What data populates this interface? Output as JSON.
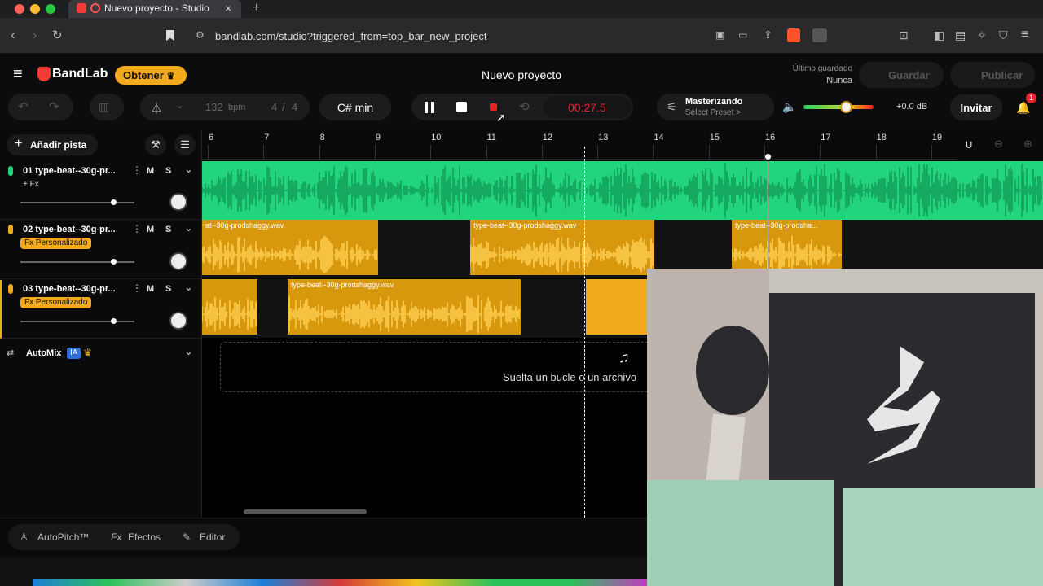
{
  "browser": {
    "tab_title": "Nuevo proyecto - Studio",
    "url": "bandlab.com/studio?triggered_from=top_bar_new_project",
    "new_tab": "+"
  },
  "app": {
    "logo": "BandLab",
    "obtener_label": "Obtener",
    "project_title": "Nuevo proyecto",
    "last_saved_label": "Último guardado",
    "last_saved_value": "Nunca",
    "save_label": "Guardar",
    "publish_label": "Publicar"
  },
  "toolbar": {
    "bpm": "132",
    "bpm_unit": "bpm",
    "time_sig_num": "4",
    "time_sig_den": "4",
    "time_sig_sep": "/",
    "key": "C# min",
    "timer": "00:27.5",
    "mastering_title": "Masterizando",
    "mastering_sub": "Select Preset >",
    "volume_db": "+0.0 dB",
    "invite_label": "Invitar",
    "notif_count": "1",
    "volume_level": 0.6
  },
  "ruler": {
    "marks": [
      "6",
      "7",
      "8",
      "9",
      "10",
      "11",
      "12",
      "13",
      "14",
      "15",
      "16",
      "17",
      "18",
      "19"
    ]
  },
  "sidebar": {
    "add_track_label": "Añadir pista",
    "automix_label": "AutoMix",
    "automix_badge": "IA",
    "tracks": [
      {
        "name": "01  type-beat--30g-pr...",
        "m": "M",
        "s": "S",
        "fx": "+ Fx",
        "volume": 0.8
      },
      {
        "name": "02  type-beat--30g-pr...",
        "m": "M",
        "s": "S",
        "fx": "Fx Personalizado",
        "volume": 0.8
      },
      {
        "name": "03  type-beat--30g-pr...",
        "m": "M",
        "s": "S",
        "fx": "Fx Personalizado",
        "volume": 0.8
      }
    ]
  },
  "clips": {
    "t2": [
      "at--30g-prodshaggy.wav",
      "type-beat--30g-prodshaggy.wav",
      "type-beat--30g-prodsha..."
    ],
    "t3": [
      "",
      "type-beat--30g-prodshaggy.wav",
      ""
    ]
  },
  "dropzone": {
    "text": "Suelta un bucle o un archivo"
  },
  "bottom": {
    "autopitch": "AutoPitch™",
    "effects": "Efectos",
    "editor": "Editor"
  },
  "colors": {
    "track1": "#22d47b",
    "track23": "#f2a91c",
    "record": "#e8232a",
    "timer": "#e8232a"
  }
}
